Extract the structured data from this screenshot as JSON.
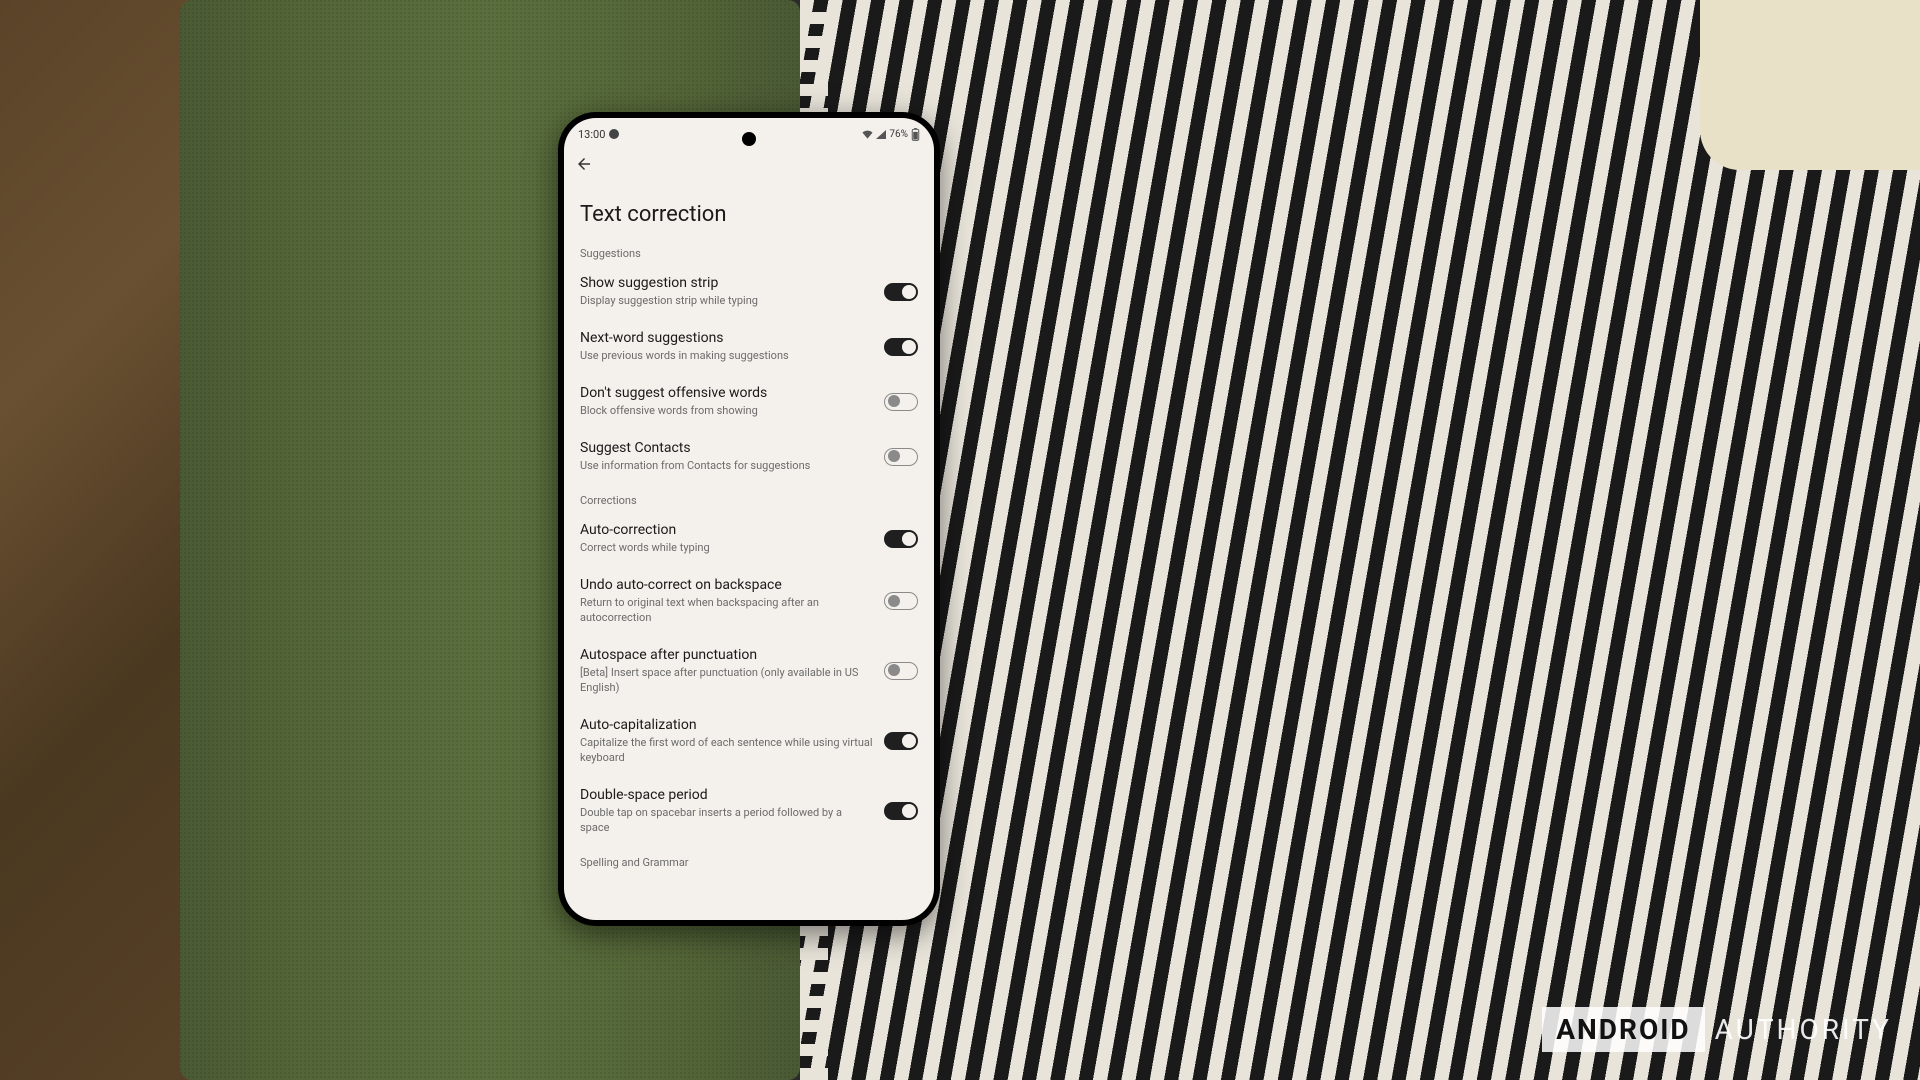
{
  "statusbar": {
    "time": "13:00",
    "battery": "76%",
    "signal_icons": "􀙇 􀙈 􀋧"
  },
  "page": {
    "title": "Text correction"
  },
  "sections": [
    {
      "header": "Suggestions",
      "items": [
        {
          "label": "Show suggestion strip",
          "sub": "Display suggestion strip while typing",
          "on": true
        },
        {
          "label": "Next-word suggestions",
          "sub": "Use previous words in making suggestions",
          "on": true
        },
        {
          "label": "Don't suggest offensive words",
          "sub": "Block offensive words from showing",
          "on": false
        },
        {
          "label": "Suggest Contacts",
          "sub": "Use information from Contacts for suggestions",
          "on": false
        }
      ]
    },
    {
      "header": "Corrections",
      "items": [
        {
          "label": "Auto-correction",
          "sub": "Correct words while typing",
          "on": true
        },
        {
          "label": "Undo auto-correct on backspace",
          "sub": "Return to original text when backspacing after an autocorrection",
          "on": false
        },
        {
          "label": "Autospace after punctuation",
          "sub": "[Beta] Insert space after punctuation (only available in US English)",
          "on": false
        },
        {
          "label": "Auto-capitalization",
          "sub": "Capitalize the first word of each sentence while using virtual keyboard",
          "on": true
        },
        {
          "label": "Double-space period",
          "sub": "Double tap on spacebar inserts a period followed by a space",
          "on": true
        }
      ]
    }
  ],
  "cutoff_section": "Spelling and Grammar",
  "watermark": {
    "brand": "ANDROID",
    "word": "AUTHORITY"
  }
}
